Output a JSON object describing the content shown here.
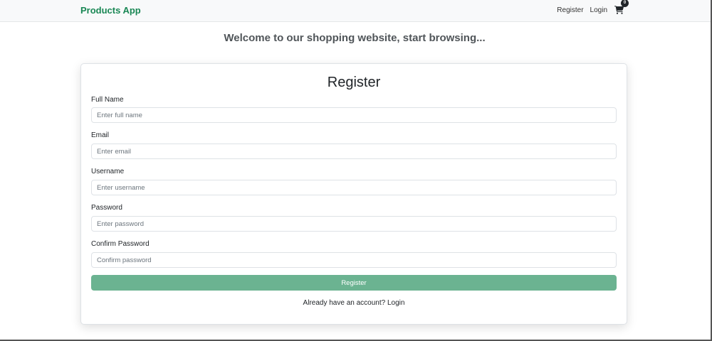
{
  "navbar": {
    "brand": "Products App",
    "links": [
      {
        "label": "Register"
      },
      {
        "label": "Login"
      }
    ],
    "cart_count": "0"
  },
  "welcome": "Welcome to our shopping website, start browsing...",
  "form": {
    "title": "Register",
    "fields": [
      {
        "label": "Full Name",
        "placeholder": "Enter full name",
        "value": ""
      },
      {
        "label": "Email",
        "placeholder": "Enter email",
        "value": ""
      },
      {
        "label": "Username",
        "placeholder": "Enter username",
        "value": ""
      },
      {
        "label": "Password",
        "placeholder": "Enter password",
        "value": ""
      },
      {
        "label": "Confirm Password",
        "placeholder": "Confirm password",
        "value": ""
      }
    ],
    "submit_label": "Register",
    "account_prompt": "Already have an account?",
    "login_link": "Login"
  },
  "colors": {
    "brand": "#198754",
    "button": "#6bb391",
    "navbar_bg": "#f8f9fa"
  },
  "icons": {
    "cart": "shopping-cart-icon"
  }
}
